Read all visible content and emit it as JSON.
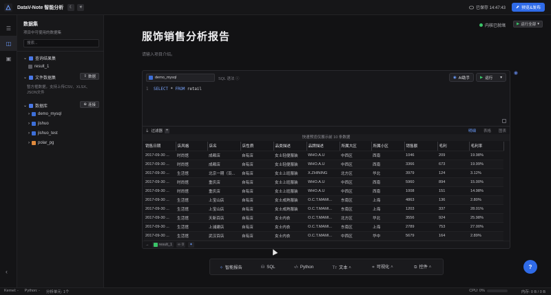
{
  "app": {
    "title": "DataV-Note 智能分析",
    "saved_text": "已保存 14:47:43",
    "publish_label": "预览&发布"
  },
  "sidebar": {
    "title": "数据集",
    "subtitle": "项目中可使用的数据集",
    "search_placeholder": "搜索...",
    "query_group": "查询结果集",
    "query_items": [
      "result_1"
    ],
    "file_group": "文件数据集",
    "file_button": "数据",
    "file_desc": "暂方框数据，支持上传CSV、XLSX、JSON文件",
    "db_group": "数据库",
    "db_button": "连接",
    "db_items": [
      "demo_mysql",
      "jishuo",
      "jishuo_test",
      "polar_pg"
    ]
  },
  "main": {
    "title": "服饰销售分析报告",
    "intro_placeholder": "请输入项目介绍。",
    "kernel_status": "内核已就绪",
    "run_all_label": "运行全部"
  },
  "cell": {
    "datasource": "demo_mysql",
    "sql_hint": "SQL 语法",
    "ai_label": "AI助手",
    "run_label": "运行",
    "code_line_no": "1",
    "code_kw1": "SELECT",
    "code_star": "*",
    "code_kw2": "FROM",
    "code_table": "retail",
    "filter_label": "过滤器",
    "view_tabs": [
      "明细",
      "表格",
      "图表"
    ],
    "preview_info": "快速预览仅展示前 10 条数据",
    "footer_result": "result_1",
    "footer_count": "0"
  },
  "table": {
    "columns": [
      "销售日期",
      "店风格",
      "店名",
      "店性质",
      "品类描述",
      "品牌描述",
      "所属大区",
      "所属小区",
      "销售额",
      "毛利",
      "毛利率"
    ],
    "rows": [
      [
        "2017-09-30 ...",
        "时尚馆",
        "成都店",
        "自有店",
        "女士轻便服装",
        "WHO.A.U",
        "中西区",
        "西南",
        "1046",
        "209",
        "19.98%"
      ],
      [
        "2017-09-30 ...",
        "时尚馆",
        "成都店",
        "自有店",
        "女士轻便服装",
        "WHO.A.U",
        "中西区",
        "西南",
        "3366",
        "673",
        "19.99%"
      ],
      [
        "2017-09-30 ...",
        "生活馆",
        "北京一期（百...",
        "自有店",
        "女士上班服装",
        "X.ZHINING",
        "北方区",
        "华北",
        "3979",
        "124",
        "3.12%"
      ],
      [
        "2017-09-30 ...",
        "时尚馆",
        "重庆店",
        "自有店",
        "女士上班服装",
        "WHO.A.U",
        "中西区",
        "西南",
        "5960",
        "894",
        "15.00%"
      ],
      [
        "2017-09-30 ...",
        "时尚馆",
        "重庆店",
        "自有店",
        "女士上班服装",
        "WHO.A.U",
        "中西区",
        "西南",
        "1008",
        "151",
        "14.98%"
      ],
      [
        "2017-09-30 ...",
        "生活馆",
        "上宝山店",
        "自有店",
        "女士成熟服装",
        "O.C.T.MAMI...",
        "东南区",
        "上海",
        "4863",
        "136",
        "2.80%"
      ],
      [
        "2017-09-30 ...",
        "生活馆",
        "上宝山店",
        "自有店",
        "女士成熟服装",
        "O.C.T.MAMI...",
        "东南区",
        "上海",
        "1203",
        "337",
        "28.01%"
      ],
      [
        "2017-09-30 ...",
        "生活馆",
        "天新百店",
        "自有店",
        "女士内衣",
        "O.C.T.MAMI...",
        "北方区",
        "华北",
        "3556",
        "924",
        "25.98%"
      ],
      [
        "2017-09-30 ...",
        "生活馆",
        "上浦建店",
        "自有店",
        "女士内衣",
        "O.C.T.MAMI...",
        "东南区",
        "上海",
        "2789",
        "753",
        "27.00%"
      ],
      [
        "2017-09-30 ...",
        "生活馆",
        "武汉百店",
        "自有店",
        "女士内衣",
        "O.C.T.MAMI...",
        "中西区",
        "华中",
        "5679",
        "164",
        "2.89%"
      ]
    ]
  },
  "insert_bar": {
    "items": [
      "智能报告",
      "SQL",
      "Python",
      "文本",
      "可视化",
      "控件"
    ]
  },
  "statusbar": {
    "kernel": "Kernel: -",
    "python": "Python: -",
    "cells": "分析单元: 1个",
    "cpu": "CPU: 0%",
    "memory": "内存: 0 B / 0 B"
  },
  "colors": {
    "accent": "#2f6be8",
    "ok": "#3ac569"
  }
}
